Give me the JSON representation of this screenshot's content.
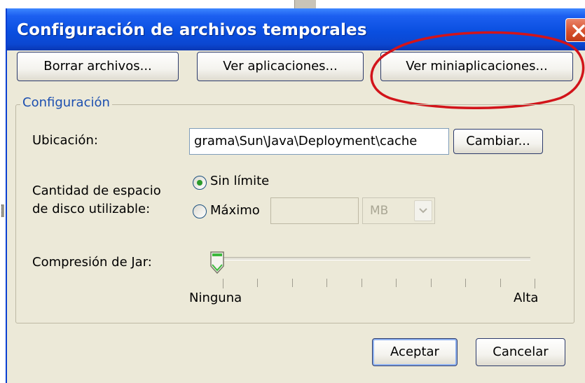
{
  "window": {
    "title": "Configuración de archivos temporales"
  },
  "toolbar": {
    "delete_files_label": "Borrar archivos...",
    "view_apps_label": "Ver aplicaciones...",
    "view_applets_label": "Ver miniaplicaciones..."
  },
  "config": {
    "group_label": "Configuración",
    "location_label": "Ubicación:",
    "location_value": "grama\\Sun\\Java\\Deployment\\cache",
    "change_label": "Cambiar...",
    "disk_space_label_line1": "Cantidad de espacio",
    "disk_space_label_line2": "de disco utilizable:",
    "unlimited_label": "Sin límite",
    "unlimited_selected": true,
    "max_label": "Máximo",
    "max_selected": false,
    "max_value": "",
    "unit_value": "MB",
    "jar_compression_label": "Compresión de Jar:",
    "jar_compression_level": 0,
    "jar_compression_ticks": 10,
    "slider_min_label": "Ninguna",
    "slider_max_label": "Alta"
  },
  "footer": {
    "ok_label": "Aceptar",
    "cancel_label": "Cancelar"
  },
  "icons": {
    "close": "close-icon",
    "dropdown": "chevron-down-icon"
  },
  "colors": {
    "titlebar": "#0a4fe0",
    "close_button": "#d6512e",
    "group_label": "#1c4fb0",
    "annotation": "#d2141a",
    "radio_dot": "#2b9a2b"
  }
}
